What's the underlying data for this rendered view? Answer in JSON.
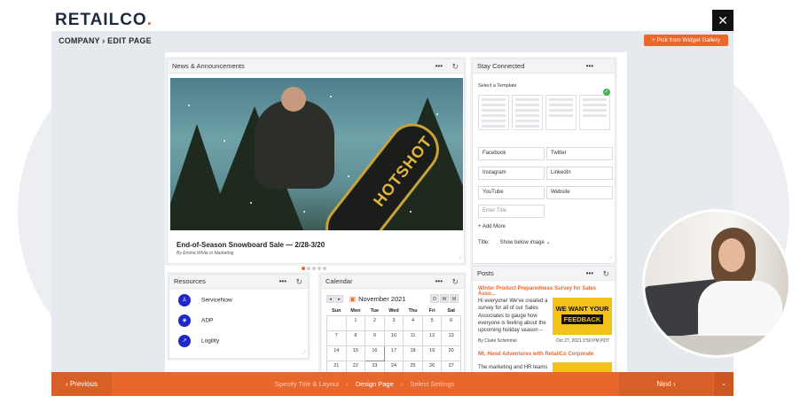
{
  "brand": {
    "name": "RETAILCO",
    "dot": ".",
    "accent": "#e8672d"
  },
  "header": {
    "close_glyph": "✕",
    "breadcrumb": "COMPANY › EDIT PAGE",
    "pick_button": "+  Pick from Widget Gallery"
  },
  "news": {
    "title": "News & Announcements",
    "more": "•••",
    "refresh": "↻",
    "image_text": "HOTSHOT",
    "headline": "End-of-Season Snowboard Sale — 2/28-3/20",
    "byline": "By Emma White in Marketing",
    "slide_count": 5,
    "active_slide": 1
  },
  "stay": {
    "title": "Stay Connected",
    "select_label": "Select a Template",
    "fields": [
      "Facebook",
      "Twitter",
      "Instagram",
      "LinkedIn",
      "YouTube",
      "Website"
    ],
    "enter_title_placeholder": "Enter Title",
    "add_more": "+ Add More",
    "title_label": "Title:",
    "title_value": "Show below image ⌄"
  },
  "resources": {
    "title": "Resources",
    "items": [
      {
        "label": "ServiceNow",
        "icon": "user-icon",
        "glyph": "♙"
      },
      {
        "label": "ADP",
        "icon": "shield-icon",
        "glyph": "◈"
      },
      {
        "label": "Logility",
        "icon": "chart-icon",
        "glyph": "↗"
      }
    ]
  },
  "calendar": {
    "title": "Calendar",
    "nav": [
      "◂",
      "▸"
    ],
    "month": "November 2021",
    "views": [
      "D",
      "W",
      "M"
    ],
    "days": [
      "Sun",
      "Mon",
      "Tue",
      "Wed",
      "Thu",
      "Fri",
      "Sat"
    ],
    "weeks": [
      [
        "",
        "1",
        "2",
        "3",
        "4",
        "5",
        "6"
      ],
      [
        "7",
        "8",
        "9",
        "10",
        "11",
        "12",
        "13"
      ],
      [
        "14",
        "15",
        "16",
        "17",
        "18",
        "19",
        "20"
      ],
      [
        "21",
        "22",
        "23",
        "24",
        "25",
        "26",
        "27"
      ]
    ],
    "highlight": "16"
  },
  "posts": {
    "title": "Posts",
    "items": [
      {
        "title": "Winter Product Preparedness Survey for Sales Asso...",
        "body": "Hi everyone!  We've created a survey for all of our Sales Associates to gauge how everyone is feeling about the upcoming holiday season –",
        "image_line1": "WE WANT YOUR",
        "image_line2": "FEEDBACK",
        "author": "By Claire Schimmel",
        "date": "Oct 27, 2021 2:50 PM PDT"
      },
      {
        "title": "Mt. Hood Adventures with RetailCo Corporate",
        "body": "The marketing and HR teams"
      }
    ]
  },
  "footer": {
    "previous": "‹  Previous",
    "steps": [
      "Specify Title & Layout",
      "Design Page",
      "Select Settings"
    ],
    "current_step": 1,
    "separator": "›",
    "next": "Next  ›",
    "dropdown": "⌄"
  }
}
